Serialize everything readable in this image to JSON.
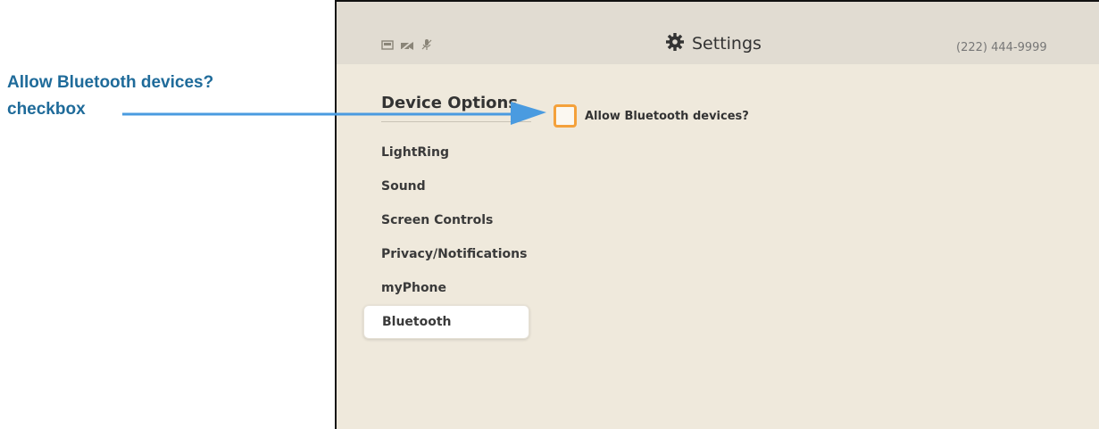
{
  "callout": {
    "line1": "Allow Bluetooth devices?",
    "line2": "checkbox"
  },
  "header": {
    "title": "Settings",
    "phone": "(222) 444-9999",
    "icons": [
      "display-icon",
      "camera-off-icon",
      "microphone-off-icon"
    ]
  },
  "sidebar": {
    "title": "Device Options",
    "items": [
      {
        "label": "LightRing"
      },
      {
        "label": "Sound"
      },
      {
        "label": "Screen Controls"
      },
      {
        "label": "Privacy/Notifications"
      },
      {
        "label": "myPhone"
      },
      {
        "label": "Bluetooth",
        "selected": true
      }
    ]
  },
  "option": {
    "label": "Allow Bluetooth devices?",
    "checked": false
  },
  "colors": {
    "callout": "#1f6b9a",
    "arrow": "#4a9be0",
    "checkbox_border": "#f4a13b",
    "screen_bg": "#efe9dc",
    "header_bg": "#e1dcd2"
  }
}
